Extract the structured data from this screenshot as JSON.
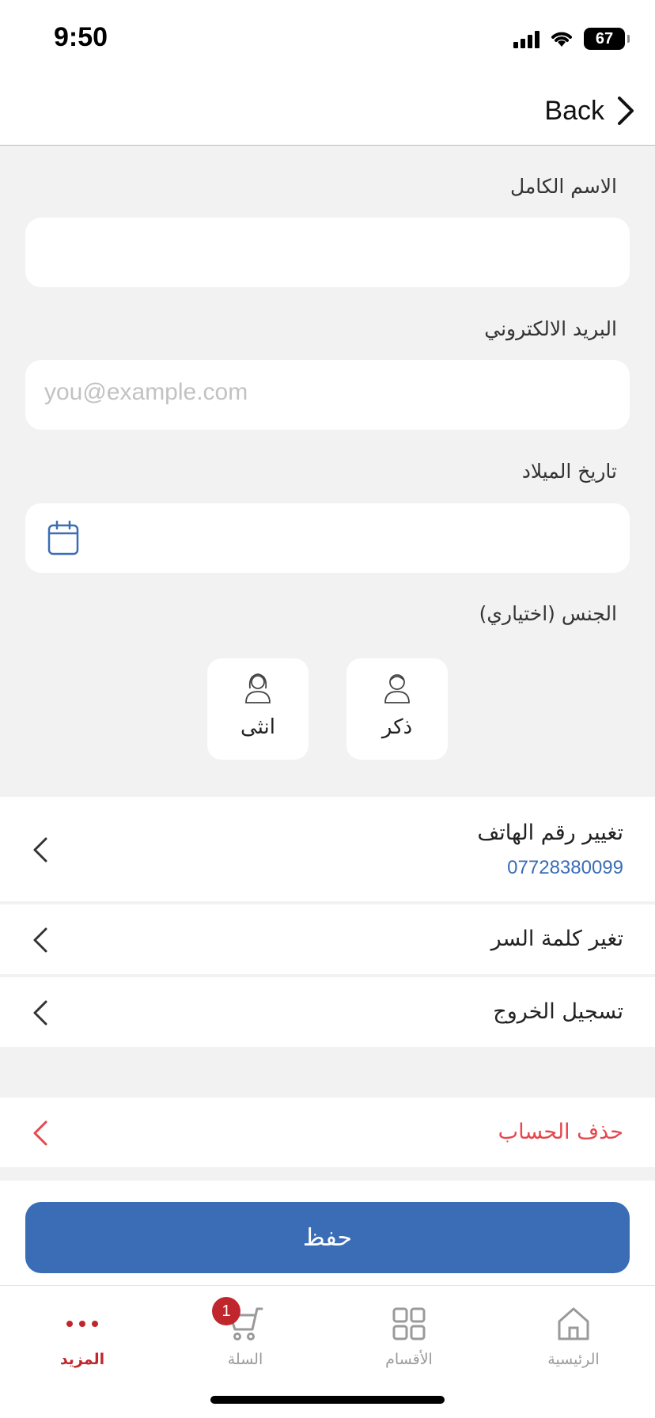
{
  "status_bar": {
    "time": "9:50",
    "battery": "67"
  },
  "nav": {
    "back_label": "Back"
  },
  "form": {
    "full_name_label": "الاسم الكامل",
    "full_name_value": "",
    "email_label": "البريد الالكتروني",
    "email_placeholder": "you@example.com",
    "birthdate_label": "تاريخ الميلاد",
    "birthdate_value": "",
    "gender_label": "الجنس (اختياري)",
    "gender_options": [
      {
        "label": "ذكر",
        "icon": "male-avatar-icon"
      },
      {
        "label": "انثى",
        "icon": "female-avatar-icon"
      }
    ]
  },
  "settings": {
    "change_phone_title": "تغيير رقم الهاتف",
    "phone_number": "07728380099",
    "change_password": "تغير كلمة السر",
    "logout": "تسجيل الخروج",
    "delete_account": "حذف الحساب"
  },
  "save_label": "حفظ",
  "tabbar": {
    "home": "الرئيسية",
    "categories": "الأقسام",
    "cart": "السلة",
    "cart_badge": "1",
    "more": "المزيد",
    "active": "more"
  },
  "colors": {
    "primary": "#3a6db6",
    "danger": "#e5474d",
    "active_tab": "#c0272d",
    "background": "#f2f2f2"
  }
}
